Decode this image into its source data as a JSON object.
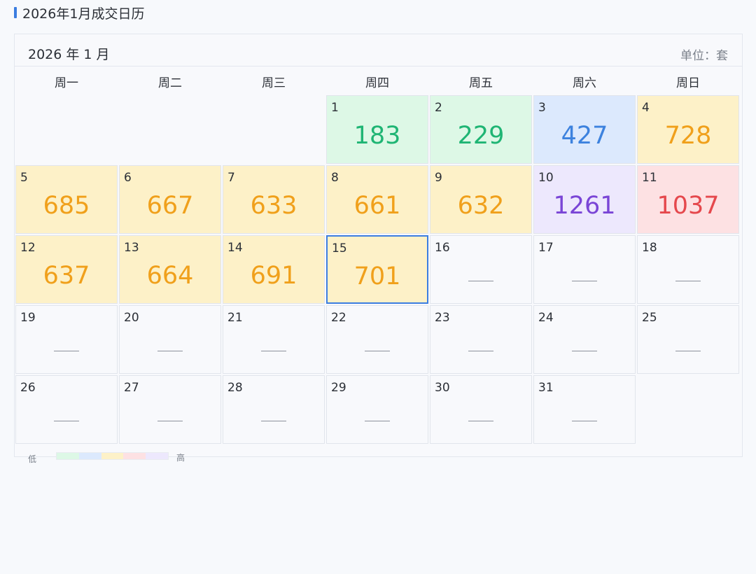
{
  "page": {
    "title": "2026年1月成交日历"
  },
  "panel": {
    "month_label": "2026 年 1 月",
    "unit_label": "单位：套"
  },
  "weekdays": [
    "周一",
    "周二",
    "周三",
    "周四",
    "周五",
    "周六",
    "周日"
  ],
  "levels": {
    "green": {
      "bg": "#ddf8e6",
      "fg": "#1fb574"
    },
    "blue": {
      "bg": "#dce9fd",
      "fg": "#3d82de"
    },
    "yellow": {
      "bg": "#fdf1c8",
      "fg": "#f0a01b"
    },
    "purple": {
      "bg": "#ede8fd",
      "fg": "#7a45d6"
    },
    "red": {
      "bg": "#fde1e3",
      "fg": "#e5484d"
    }
  },
  "calendar": {
    "leading_blanks": 3,
    "today": 15,
    "days": [
      {
        "day": "1",
        "value": "183",
        "level": "green"
      },
      {
        "day": "2",
        "value": "229",
        "level": "green"
      },
      {
        "day": "3",
        "value": "427",
        "level": "blue"
      },
      {
        "day": "4",
        "value": "728",
        "level": "yellow"
      },
      {
        "day": "5",
        "value": "685",
        "level": "yellow"
      },
      {
        "day": "6",
        "value": "667",
        "level": "yellow"
      },
      {
        "day": "7",
        "value": "633",
        "level": "yellow"
      },
      {
        "day": "8",
        "value": "661",
        "level": "yellow"
      },
      {
        "day": "9",
        "value": "632",
        "level": "yellow"
      },
      {
        "day": "10",
        "value": "1261",
        "level": "purple"
      },
      {
        "day": "11",
        "value": "1037",
        "level": "red"
      },
      {
        "day": "12",
        "value": "637",
        "level": "yellow"
      },
      {
        "day": "13",
        "value": "664",
        "level": "yellow"
      },
      {
        "day": "14",
        "value": "691",
        "level": "yellow"
      },
      {
        "day": "15",
        "value": "701",
        "level": "yellow"
      },
      {
        "day": "16",
        "value": null
      },
      {
        "day": "17",
        "value": null
      },
      {
        "day": "18",
        "value": null
      },
      {
        "day": "19",
        "value": null
      },
      {
        "day": "20",
        "value": null
      },
      {
        "day": "21",
        "value": null
      },
      {
        "day": "22",
        "value": null
      },
      {
        "day": "23",
        "value": null
      },
      {
        "day": "24",
        "value": null
      },
      {
        "day": "25",
        "value": null
      },
      {
        "day": "26",
        "value": null
      },
      {
        "day": "27",
        "value": null
      },
      {
        "day": "28",
        "value": null
      },
      {
        "day": "29",
        "value": null
      },
      {
        "day": "30",
        "value": null
      },
      {
        "day": "31",
        "value": null
      }
    ]
  },
  "legend": {
    "low_label": "低",
    "high_label": "高",
    "colors": [
      "#ddf8e6",
      "#dce9fd",
      "#fdf1c8",
      "#fde1e3",
      "#ede8fd"
    ]
  }
}
